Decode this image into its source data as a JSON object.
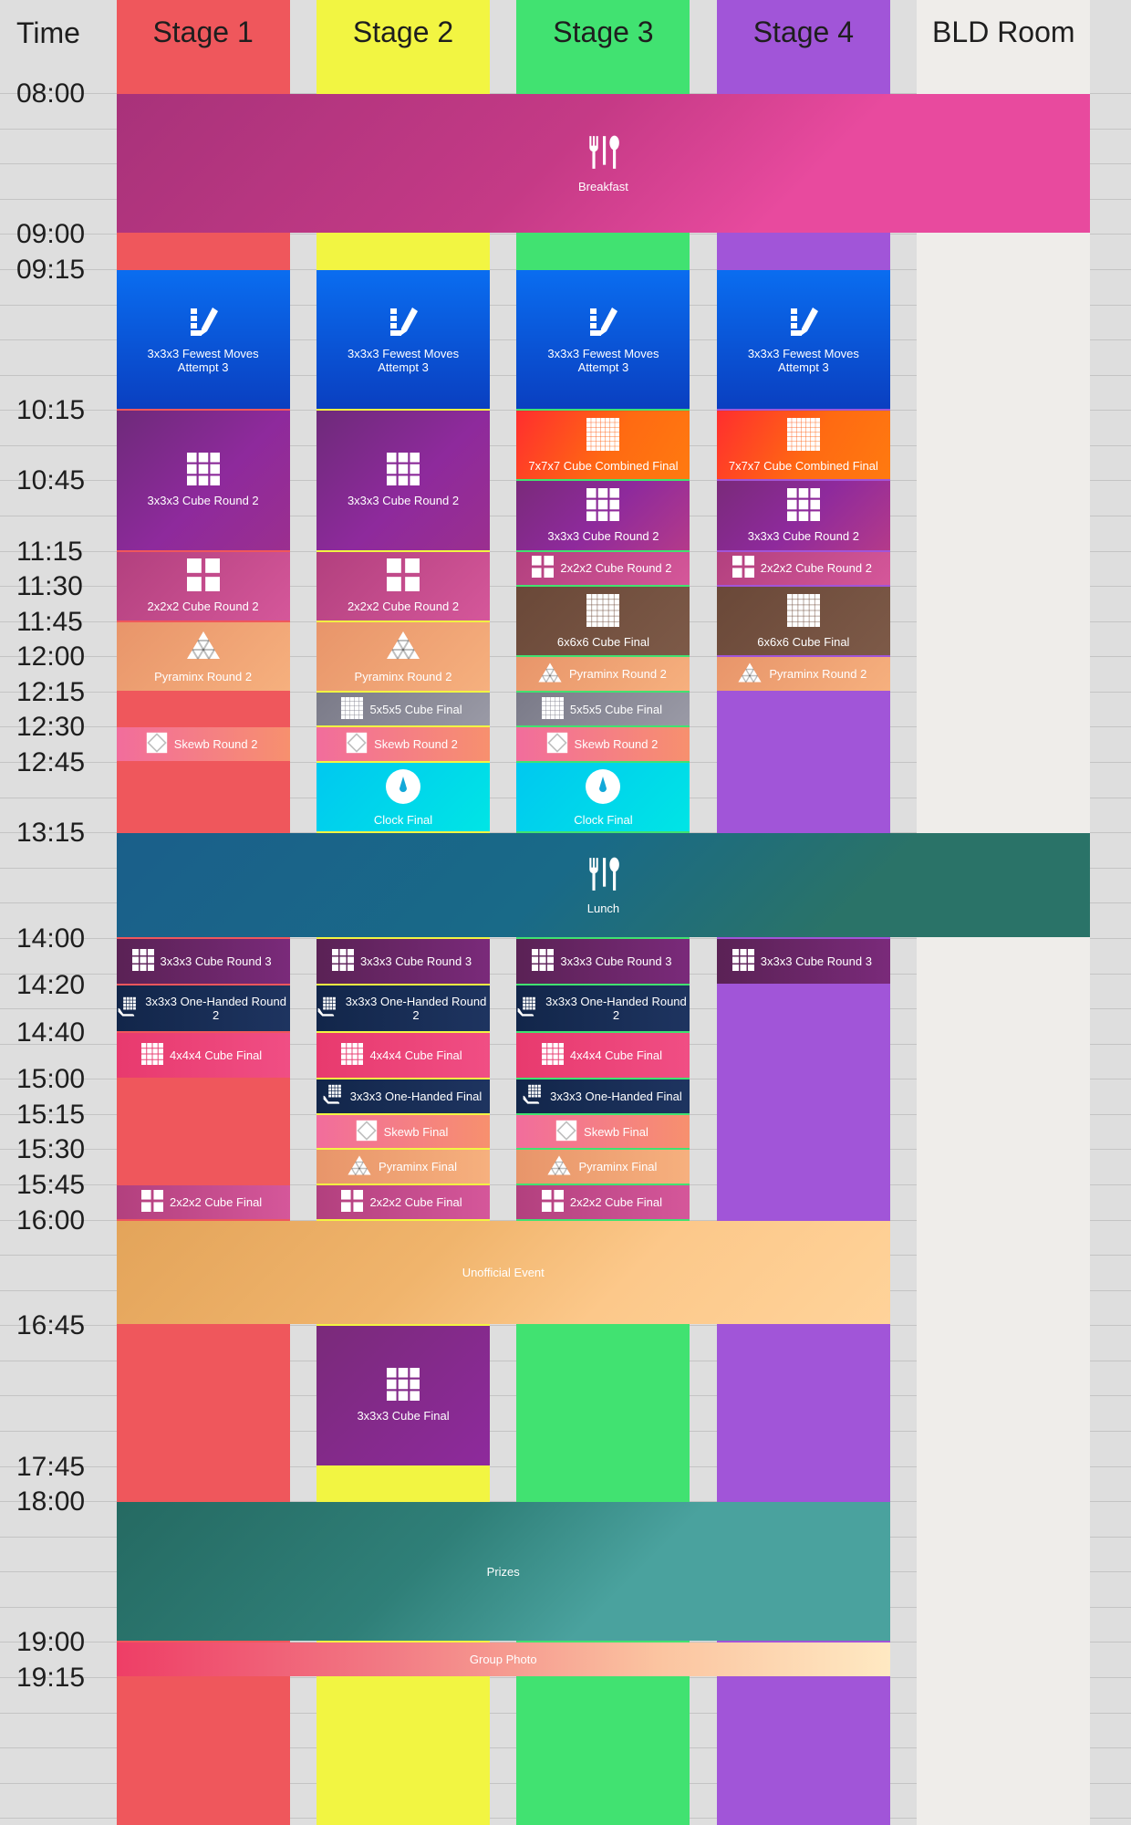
{
  "columns": [
    {
      "id": "time",
      "name": "Time"
    },
    {
      "id": "s1",
      "name": "Stage 1",
      "color": "#ef575c"
    },
    {
      "id": "s2",
      "name": "Stage 2",
      "color": "#f2f542"
    },
    {
      "id": "s3",
      "name": "Stage 3",
      "color": "#41e271"
    },
    {
      "id": "s4",
      "name": "Stage 4",
      "color": "#a155d8"
    },
    {
      "id": "bld",
      "name": "BLD Room",
      "color": "#efedea"
    }
  ],
  "time_labels": [
    "08:00",
    "09:00",
    "09:15",
    "10:15",
    "10:45",
    "11:15",
    "11:30",
    "11:45",
    "12:00",
    "12:15",
    "12:30",
    "12:45",
    "13:15",
    "14:00",
    "14:20",
    "14:40",
    "15:00",
    "15:15",
    "15:30",
    "15:45",
    "16:00",
    "16:45",
    "17:45",
    "18:00",
    "19:00",
    "19:15"
  ],
  "events": [
    {
      "label": "Breakfast",
      "start": "08:00",
      "end": "09:00",
      "cols": [
        "s1",
        "s2",
        "s3",
        "s4",
        "bld"
      ],
      "icon": "fork-spoon-icon",
      "layout": "v",
      "bg": "linear-gradient(135deg,#a8327a 0%,#c53a86 45%,#e84a9e 70%,#e84a9e 100%)"
    },
    {
      "label": "3x3x3 Fewest Moves\nAttempt 3",
      "start": "09:15",
      "end": "10:15",
      "cols": [
        "s1"
      ],
      "icon": "pencil-icon",
      "layout": "v",
      "bg": "linear-gradient(180deg,#0a6df0 0%,#0a3fc0 100%)"
    },
    {
      "label": "3x3x3 Fewest Moves\nAttempt 3",
      "start": "09:15",
      "end": "10:15",
      "cols": [
        "s2"
      ],
      "icon": "pencil-icon",
      "layout": "v",
      "bg": "linear-gradient(180deg,#0a6df0 0%,#0a3fc0 100%)"
    },
    {
      "label": "3x3x3 Fewest Moves\nAttempt 3",
      "start": "09:15",
      "end": "10:15",
      "cols": [
        "s3"
      ],
      "icon": "pencil-icon",
      "layout": "v",
      "bg": "linear-gradient(180deg,#0a6df0 0%,#0a3fc0 100%)"
    },
    {
      "label": "3x3x3 Fewest Moves\nAttempt 3",
      "start": "09:15",
      "end": "10:15",
      "cols": [
        "s4"
      ],
      "icon": "pencil-icon",
      "layout": "v",
      "bg": "linear-gradient(180deg,#0a6df0 0%,#0a3fc0 100%)"
    },
    {
      "label": "3x3x3 Cube Round 2",
      "start": "10:15",
      "end": "11:15",
      "cols": [
        "s1"
      ],
      "icon": "grid3-icon",
      "layout": "v",
      "bg": "linear-gradient(135deg,#6e2a7a 0%,#8e2a9c 55%,#9b2f8f 100%)"
    },
    {
      "label": "3x3x3 Cube Round 2",
      "start": "10:15",
      "end": "11:15",
      "cols": [
        "s2"
      ],
      "icon": "grid3-icon",
      "layout": "v",
      "bg": "linear-gradient(135deg,#6e2a7a 0%,#8e2a9c 55%,#9b2f8f 100%)"
    },
    {
      "label": "7x7x7 Cube Combined Final",
      "start": "10:15",
      "end": "10:45",
      "cols": [
        "s3"
      ],
      "icon": "grid7-icon",
      "layout": "v",
      "bg": "linear-gradient(120deg,#ff2e2e 0%,#ff6a12 55%,#ff7a10 100%)"
    },
    {
      "label": "7x7x7 Cube Combined Final",
      "start": "10:15",
      "end": "10:45",
      "cols": [
        "s4"
      ],
      "icon": "grid7-icon",
      "layout": "v",
      "bg": "linear-gradient(120deg,#ff2e2e 0%,#ff6a12 55%,#ff7a10 100%)"
    },
    {
      "label": "3x3x3 Cube Round 2",
      "start": "10:45",
      "end": "11:15",
      "cols": [
        "s3"
      ],
      "icon": "grid3-icon",
      "layout": "v",
      "bg": "linear-gradient(135deg,#7a2a7a 0%,#8e2a9c 50%,#b43a8a 100%)"
    },
    {
      "label": "3x3x3 Cube Round 2",
      "start": "10:45",
      "end": "11:15",
      "cols": [
        "s4"
      ],
      "icon": "grid3-icon",
      "layout": "v",
      "bg": "linear-gradient(135deg,#7a2a7a 0%,#8e2a9c 50%,#b43a8a 100%)"
    },
    {
      "label": "2x2x2 Cube Round 2",
      "start": "11:15",
      "end": "11:45",
      "cols": [
        "s1"
      ],
      "icon": "grid2-icon",
      "layout": "v",
      "bg": "linear-gradient(135deg,#b2407e 0%,#d5579a 100%)"
    },
    {
      "label": "2x2x2 Cube Round 2",
      "start": "11:15",
      "end": "11:45",
      "cols": [
        "s2"
      ],
      "icon": "grid2-icon",
      "layout": "v",
      "bg": "linear-gradient(135deg,#b2407e 0%,#d5579a 100%)"
    },
    {
      "label": "2x2x2 Cube Round 2",
      "start": "11:15",
      "end": "11:30",
      "cols": [
        "s3"
      ],
      "icon": "grid2-icon",
      "layout": "h",
      "bg": "linear-gradient(135deg,#b2407e 0%,#d5579a 100%)"
    },
    {
      "label": "2x2x2 Cube Round 2",
      "start": "11:15",
      "end": "11:30",
      "cols": [
        "s4"
      ],
      "icon": "grid2-icon",
      "layout": "h",
      "bg": "linear-gradient(135deg,#b2407e 0%,#d5579a 100%)"
    },
    {
      "label": "Pyraminx Round 2",
      "start": "11:45",
      "end": "12:15",
      "cols": [
        "s1"
      ],
      "icon": "pyraminx-icon",
      "layout": "v",
      "bg": "linear-gradient(135deg,#e8956a 0%,#f6b07e 100%)"
    },
    {
      "label": "Pyraminx Round 2",
      "start": "11:45",
      "end": "12:15",
      "cols": [
        "s2"
      ],
      "icon": "pyraminx-icon",
      "layout": "v",
      "bg": "linear-gradient(135deg,#e8956a 0%,#f6b07e 100%)"
    },
    {
      "label": "6x6x6 Cube Final",
      "start": "11:30",
      "end": "12:00",
      "cols": [
        "s3"
      ],
      "icon": "grid6-icon",
      "layout": "v",
      "bg": "linear-gradient(135deg,#6a4838 0%,#7d5a48 100%)"
    },
    {
      "label": "6x6x6 Cube Final",
      "start": "11:30",
      "end": "12:00",
      "cols": [
        "s4"
      ],
      "icon": "grid6-icon",
      "layout": "v",
      "bg": "linear-gradient(135deg,#6a4838 0%,#7d5a48 100%)"
    },
    {
      "label": "Pyraminx Round 2",
      "start": "12:00",
      "end": "12:15",
      "cols": [
        "s3"
      ],
      "icon": "pyraminx-icon",
      "layout": "h",
      "bg": "linear-gradient(135deg,#e8956a 0%,#f6b07e 100%)"
    },
    {
      "label": "Pyraminx Round 2",
      "start": "12:00",
      "end": "12:15",
      "cols": [
        "s4"
      ],
      "icon": "pyraminx-icon",
      "layout": "h",
      "bg": "linear-gradient(135deg,#e8956a 0%,#f6b07e 100%)"
    },
    {
      "label": "5x5x5 Cube Final",
      "start": "12:15",
      "end": "12:30",
      "cols": [
        "s2"
      ],
      "icon": "grid5-icon",
      "layout": "h",
      "bg": "linear-gradient(135deg,#7a7a88 0%,#9a9aa6 100%)"
    },
    {
      "label": "5x5x5 Cube Final",
      "start": "12:15",
      "end": "12:30",
      "cols": [
        "s3"
      ],
      "icon": "grid5-icon",
      "layout": "h",
      "bg": "linear-gradient(135deg,#7a7a88 0%,#9a9aa6 100%)"
    },
    {
      "label": "Skewb Round 2",
      "start": "12:30",
      "end": "12:45",
      "cols": [
        "s1"
      ],
      "icon": "skewb-icon",
      "layout": "h",
      "bg": "linear-gradient(90deg,#f26d9c 0%,#f7906e 100%)"
    },
    {
      "label": "Skewb Round 2",
      "start": "12:30",
      "end": "12:45",
      "cols": [
        "s2"
      ],
      "icon": "skewb-icon",
      "layout": "h",
      "bg": "linear-gradient(90deg,#f26d9c 0%,#f7906e 100%)"
    },
    {
      "label": "Skewb Round 2",
      "start": "12:30",
      "end": "12:45",
      "cols": [
        "s3"
      ],
      "icon": "skewb-icon",
      "layout": "h",
      "bg": "linear-gradient(90deg,#f26d9c 0%,#f7906e 100%)"
    },
    {
      "label": "Clock Final",
      "start": "12:45",
      "end": "13:15",
      "cols": [
        "s2"
      ],
      "icon": "clock-icon",
      "layout": "v",
      "bg": "linear-gradient(135deg,#00c8f0 0%,#00e5e5 100%)"
    },
    {
      "label": "Clock Final",
      "start": "12:45",
      "end": "13:15",
      "cols": [
        "s3"
      ],
      "icon": "clock-icon",
      "layout": "v",
      "bg": "linear-gradient(135deg,#00c8f0 0%,#00e5e5 100%)"
    },
    {
      "label": "Lunch",
      "start": "13:15",
      "end": "14:00",
      "cols": [
        "s1",
        "s2",
        "s3",
        "s4",
        "bld"
      ],
      "icon": "fork-spoon-icon",
      "layout": "v",
      "bg": "linear-gradient(135deg,#1a5f8a 0%,#196a88 45%,#2a7368 75%,#2a7368 100%)"
    },
    {
      "label": "3x3x3 Cube Round 3",
      "start": "14:00",
      "end": "14:20",
      "cols": [
        "s1"
      ],
      "icon": "grid3-icon",
      "layout": "h",
      "bg": "linear-gradient(90deg,#5a2255 0%,#7a2a7a 100%)"
    },
    {
      "label": "3x3x3 Cube Round 3",
      "start": "14:00",
      "end": "14:20",
      "cols": [
        "s2"
      ],
      "icon": "grid3-icon",
      "layout": "h",
      "bg": "linear-gradient(90deg,#5a2255 0%,#7a2a7a 100%)"
    },
    {
      "label": "3x3x3 Cube Round 3",
      "start": "14:00",
      "end": "14:20",
      "cols": [
        "s3"
      ],
      "icon": "grid3-icon",
      "layout": "h",
      "bg": "linear-gradient(90deg,#5a2255 0%,#7a2a7a 100%)"
    },
    {
      "label": "3x3x3 Cube Round 3",
      "start": "14:00",
      "end": "14:20",
      "cols": [
        "s4"
      ],
      "icon": "grid3-icon",
      "layout": "h",
      "bg": "linear-gradient(90deg,#5a2255 0%,#7a2a7a 100%)"
    },
    {
      "label": "3x3x3 One-Handed Round 2",
      "start": "14:20",
      "end": "14:40",
      "cols": [
        "s1"
      ],
      "icon": "one-hand-icon",
      "layout": "h",
      "bg": "linear-gradient(90deg,#12264a 0%,#1e3460 100%)"
    },
    {
      "label": "3x3x3 One-Handed Round 2",
      "start": "14:20",
      "end": "14:40",
      "cols": [
        "s2"
      ],
      "icon": "one-hand-icon",
      "layout": "h",
      "bg": "linear-gradient(90deg,#12264a 0%,#1e3460 100%)"
    },
    {
      "label": "3x3x3 One-Handed Round 2",
      "start": "14:20",
      "end": "14:40",
      "cols": [
        "s3"
      ],
      "icon": "one-hand-icon",
      "layout": "h",
      "bg": "linear-gradient(90deg,#12264a 0%,#1e3460 100%)"
    },
    {
      "label": "4x4x4 Cube Final",
      "start": "14:40",
      "end": "15:00",
      "cols": [
        "s1"
      ],
      "icon": "grid4-icon",
      "layout": "h",
      "bg": "linear-gradient(90deg,#e83a6e 0%,#f04e84 100%)"
    },
    {
      "label": "4x4x4 Cube Final",
      "start": "14:40",
      "end": "15:00",
      "cols": [
        "s2"
      ],
      "icon": "grid4-icon",
      "layout": "h",
      "bg": "linear-gradient(90deg,#e83a6e 0%,#f04e84 100%)"
    },
    {
      "label": "4x4x4 Cube Final",
      "start": "14:40",
      "end": "15:00",
      "cols": [
        "s3"
      ],
      "icon": "grid4-icon",
      "layout": "h",
      "bg": "linear-gradient(90deg,#e83a6e 0%,#f04e84 100%)"
    },
    {
      "label": "3x3x3 One-Handed Final",
      "start": "15:00",
      "end": "15:15",
      "cols": [
        "s2"
      ],
      "icon": "one-hand-icon",
      "layout": "h",
      "bg": "linear-gradient(90deg,#12264a 0%,#1e3460 100%)"
    },
    {
      "label": "3x3x3 One-Handed Final",
      "start": "15:00",
      "end": "15:15",
      "cols": [
        "s3"
      ],
      "icon": "one-hand-icon",
      "layout": "h",
      "bg": "linear-gradient(90deg,#12264a 0%,#1e3460 100%)"
    },
    {
      "label": "Skewb Final",
      "start": "15:15",
      "end": "15:30",
      "cols": [
        "s2"
      ],
      "icon": "skewb-icon",
      "layout": "h",
      "bg": "linear-gradient(90deg,#f26d9c 0%,#f7906e 100%)"
    },
    {
      "label": "Skewb Final",
      "start": "15:15",
      "end": "15:30",
      "cols": [
        "s3"
      ],
      "icon": "skewb-icon",
      "layout": "h",
      "bg": "linear-gradient(90deg,#f26d9c 0%,#f7906e 100%)"
    },
    {
      "label": "Pyraminx Final",
      "start": "15:30",
      "end": "15:45",
      "cols": [
        "s2"
      ],
      "icon": "pyraminx-icon",
      "layout": "h",
      "bg": "linear-gradient(90deg,#e8956a 0%,#f6b07e 100%)"
    },
    {
      "label": "Pyraminx Final",
      "start": "15:30",
      "end": "15:45",
      "cols": [
        "s3"
      ],
      "icon": "pyraminx-icon",
      "layout": "h",
      "bg": "linear-gradient(90deg,#e8956a 0%,#f6b07e 100%)"
    },
    {
      "label": "2x2x2 Cube Final",
      "start": "15:45",
      "end": "16:00",
      "cols": [
        "s1"
      ],
      "icon": "grid2-icon",
      "layout": "h",
      "bg": "linear-gradient(90deg,#b2407e 0%,#d5579a 100%)"
    },
    {
      "label": "2x2x2 Cube Final",
      "start": "15:45",
      "end": "16:00",
      "cols": [
        "s2"
      ],
      "icon": "grid2-icon",
      "layout": "h",
      "bg": "linear-gradient(90deg,#b2407e 0%,#d5579a 100%)"
    },
    {
      "label": "2x2x2 Cube Final",
      "start": "15:45",
      "end": "16:00",
      "cols": [
        "s3"
      ],
      "icon": "grid2-icon",
      "layout": "h",
      "bg": "linear-gradient(90deg,#b2407e 0%,#d5579a 100%)"
    },
    {
      "label": "Unofficial Event",
      "start": "16:00",
      "end": "16:45",
      "cols": [
        "s1",
        "s2",
        "s3",
        "s4"
      ],
      "icon": "",
      "layout": "v",
      "bg": "linear-gradient(135deg,#e3a45a 0%,#f0b46c 40%,#fcc88a 65%,#ffd39a 100%)"
    },
    {
      "label": "3x3x3 Cube Final",
      "start": "16:45",
      "end": "17:45",
      "cols": [
        "s2"
      ],
      "icon": "grid3-icon",
      "layout": "v",
      "bg": "linear-gradient(135deg,#7a2a7a 0%,#8e2a9c 100%)"
    },
    {
      "label": "Prizes",
      "start": "18:00",
      "end": "19:00",
      "cols": [
        "s1",
        "s2",
        "s3",
        "s4"
      ],
      "icon": "",
      "layout": "v",
      "bg": "linear-gradient(135deg,#256a62 0%,#2f7f78 40%,#4aa29e 65%,#4aa29e 100%)"
    },
    {
      "label": "Group Photo",
      "start": "19:00",
      "end": "19:15",
      "cols": [
        "s1",
        "s2",
        "s3",
        "s4"
      ],
      "icon": "",
      "layout": "v",
      "bg": "linear-gradient(90deg,#ee3e66 0%,#f27a84 35%,#fbc4a0 70%,#ffe9c2 100%)"
    }
  ]
}
